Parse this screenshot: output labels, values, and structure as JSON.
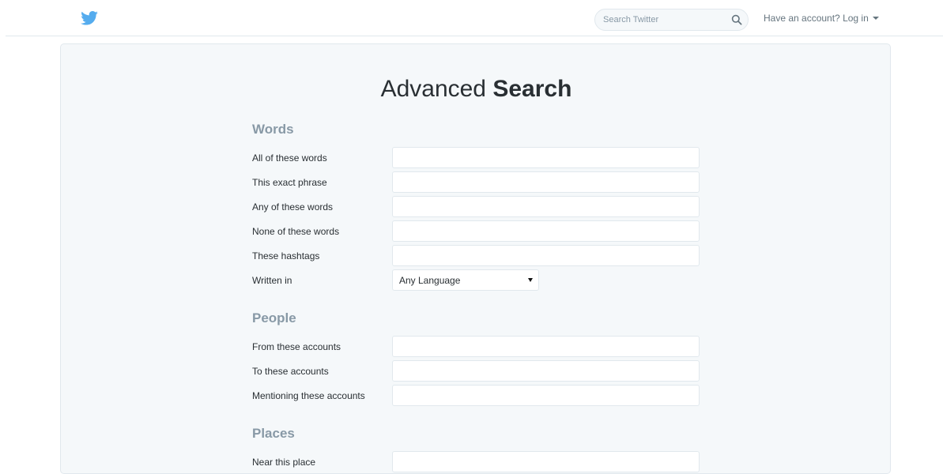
{
  "header": {
    "search": {
      "placeholder": "Search Twitter"
    },
    "login_label": "Have an account? Log in"
  },
  "page": {
    "title_light": "Advanced ",
    "title_bold": "Search"
  },
  "sections": {
    "words": {
      "title": "Words",
      "all_words": {
        "label": "All of these words",
        "value": ""
      },
      "exact_phrase": {
        "label": "This exact phrase",
        "value": ""
      },
      "any_words": {
        "label": "Any of these words",
        "value": ""
      },
      "none_words": {
        "label": "None of these words",
        "value": ""
      },
      "hashtags": {
        "label": "These hashtags",
        "value": ""
      },
      "written_in": {
        "label": "Written in",
        "selected": "Any Language"
      }
    },
    "people": {
      "title": "People",
      "from_accounts": {
        "label": "From these accounts",
        "value": ""
      },
      "to_accounts": {
        "label": "To these accounts",
        "value": ""
      },
      "mentioning_accounts": {
        "label": "Mentioning these accounts",
        "value": ""
      }
    },
    "places": {
      "title": "Places",
      "near_place": {
        "label": "Near this place",
        "value": ""
      }
    }
  },
  "icons": {
    "logo": "twitter-bird-icon",
    "search": "search-icon",
    "dropdown": "caret-down-icon"
  },
  "colors": {
    "brand": "#55acee",
    "section_title": "#8899a6",
    "panel_bg": "#f5f8fa",
    "border": "#e1e8ed"
  }
}
